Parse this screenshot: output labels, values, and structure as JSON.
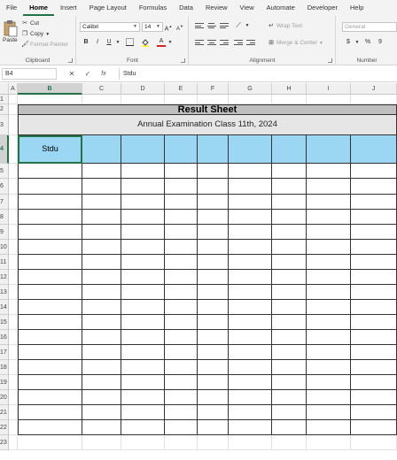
{
  "menu": {
    "tabs": [
      "File",
      "Home",
      "Insert",
      "Page Layout",
      "Formulas",
      "Data",
      "Review",
      "View",
      "Automate",
      "Developer",
      "Help"
    ],
    "active_index": 1
  },
  "ribbon": {
    "clipboard": {
      "paste_label": "Paste",
      "cut_label": "Cut",
      "copy_label": "Copy",
      "format_painter_label": "Format Painter",
      "group_label": "Clipboard"
    },
    "font": {
      "font_name": "Calibri",
      "font_size": "14",
      "bold": "B",
      "italic": "I",
      "underline": "U",
      "grow": "A",
      "shrink": "A",
      "font_color": "A",
      "group_label": "Font"
    },
    "alignment": {
      "wrap_text_label": "Wrap Text",
      "merge_center_label": "Merge & Center",
      "group_label": "Alignment"
    },
    "number": {
      "format_value": "General",
      "currency": "$",
      "percent": "%",
      "comma": "9",
      "group_label": "Number"
    }
  },
  "formula_bar": {
    "name_box": "B4",
    "cancel": "✕",
    "enter": "✓",
    "fx": "fx",
    "content": "Stdu"
  },
  "grid": {
    "columns": [
      "A",
      "B",
      "C",
      "D",
      "E",
      "F",
      "G",
      "H",
      "I",
      "J"
    ],
    "selected_column": "B",
    "rows": [
      "1",
      "2",
      "3",
      "4",
      "5",
      "6",
      "7",
      "8",
      "9",
      "10",
      "11",
      "12",
      "13",
      "14",
      "15",
      "16",
      "17",
      "18",
      "19",
      "20",
      "21",
      "22",
      "23"
    ],
    "selected_row": "4"
  },
  "sheet": {
    "title": "Result Sheet",
    "subtitle": "Annual Examination Class 11th, 2024",
    "first_header": "Stdu",
    "title_fill": "#bfbfbf",
    "subtitle_fill": "#e7e6e6",
    "header_fill": "#9bd7f3"
  },
  "colors": {
    "accent": "#217346"
  }
}
